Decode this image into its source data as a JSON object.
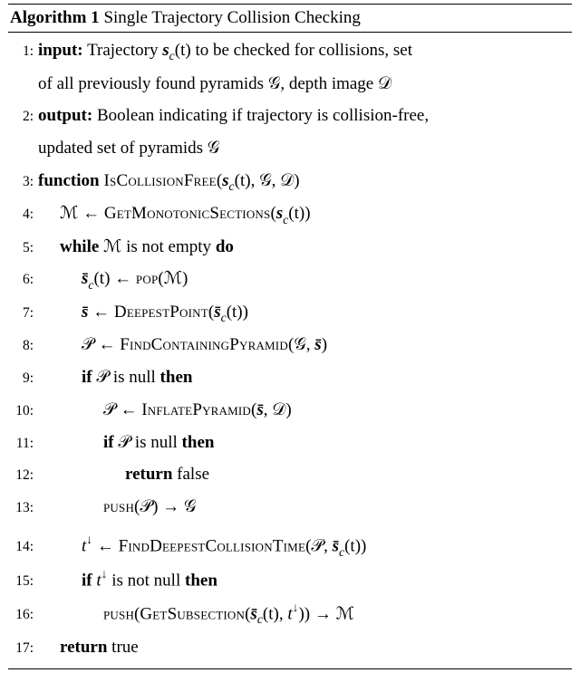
{
  "title": {
    "label": "Algorithm 1",
    "name": "Single Trajectory Collision Checking"
  },
  "lines": {
    "l1": {
      "no": "1:",
      "kw": "input:",
      "text_a": "Trajectory ",
      "sc": "s",
      "sub": "c",
      "arg": "(t)",
      "text_b": " to be checked for collisions, set"
    },
    "l1b": {
      "text": "of all previously found pyramids ",
      "g": "𝒢",
      "comma": ", depth image ",
      "d": "𝒟"
    },
    "l2": {
      "no": "2:",
      "kw": "output:",
      "text": " Boolean indicating if trajectory is collision-free,"
    },
    "l2b": {
      "text": "updated set of pyramids ",
      "g": "𝒢"
    },
    "l3": {
      "no": "3:",
      "kw": "function",
      "fn": " IsCollisionFree",
      "open": "(",
      "s": "s",
      "sub": "c",
      "arg": "(t)",
      "c1": ", ",
      "g": "𝒢",
      "c2": ", ",
      "d": "𝒟",
      "close": ")"
    },
    "l4": {
      "no": "4:",
      "m": "ℳ",
      "arrow": " ← ",
      "fn": "GetMonotonicSections",
      "open": "(",
      "s": "s",
      "sub": "c",
      "arg": "(t)",
      "close": ")"
    },
    "l5": {
      "no": "5:",
      "kw": "while ",
      "m": "ℳ",
      "text": " is not empty ",
      "kw2": "do"
    },
    "l6": {
      "no": "6:",
      "sbar": "s̄",
      "sub": "c",
      "arg": "(t)",
      "arrow": " ← ",
      "fn": "pop",
      "open": "(",
      "m": "ℳ",
      "close": ")"
    },
    "l7": {
      "no": "7:",
      "sbar": "s̄",
      "arrow": " ← ",
      "fn": "DeepestPoint",
      "open": "(",
      "sbar2": "s̄",
      "sub": "c",
      "arg": "(t)",
      "close": ")"
    },
    "l8": {
      "no": "8:",
      "p": "𝒫",
      "arrow": " ← ",
      "fn": "FindContainingPyramid",
      "open": "(",
      "g": "𝒢",
      "c": ", ",
      "sbar": "s̄",
      "close": ")"
    },
    "l9": {
      "no": "9:",
      "kw": "if ",
      "p": "𝒫",
      "text": " is null ",
      "kw2": "then"
    },
    "l10": {
      "no": "10:",
      "p": "𝒫",
      "arrow": " ← ",
      "fn": "InflatePyramid",
      "open": "(",
      "sbar": "s̄",
      "c": ", ",
      "d": "𝒟",
      "close": ")"
    },
    "l11": {
      "no": "11:",
      "kw": "if ",
      "p": "𝒫",
      "text": " is null ",
      "kw2": "then"
    },
    "l12": {
      "no": "12:",
      "kw": "return ",
      "text": "false"
    },
    "l13": {
      "no": "13:",
      "fn": "push",
      "open": "(",
      "p": "𝒫",
      "close": ")",
      "arrow": " → ",
      "g": "𝒢"
    },
    "l14": {
      "no": "14:",
      "t": "t",
      "sup": "↓",
      "arrow": " ← ",
      "fn": "FindDeepestCollisionTime",
      "open": "(",
      "p": "𝒫",
      "c": ", ",
      "sbar": "s̄",
      "sub": "c",
      "arg": "(t)",
      "close": ")"
    },
    "l15": {
      "no": "15:",
      "kw": "if ",
      "t": "t",
      "sup": "↓",
      "text": " is not null ",
      "kw2": "then"
    },
    "l16": {
      "no": "16:",
      "fn": "push",
      "open": "(",
      "fn2": "GetSubsection",
      "open2": "(",
      "sbar": "s̄",
      "sub": "c",
      "arg": "(t)",
      "c": ", ",
      "t": "t",
      "sup": "↓",
      "close2": ")",
      "close": ")",
      "arrow": " → ",
      "m": "ℳ"
    },
    "l17": {
      "no": "17:",
      "kw": "return ",
      "text": "true"
    }
  }
}
